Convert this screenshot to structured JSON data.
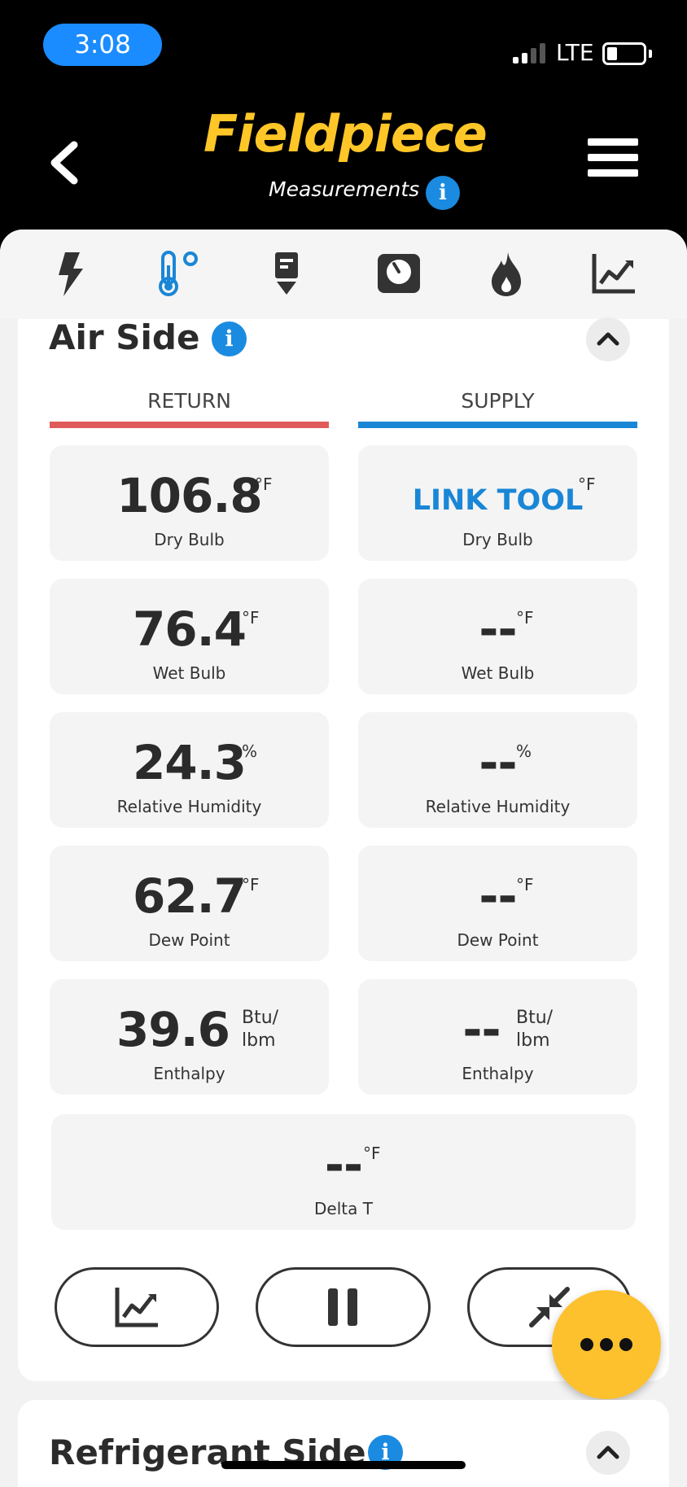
{
  "status": {
    "time": "3:08",
    "network": "LTE"
  },
  "header": {
    "brand": "Fieldpiece",
    "subtitle": "Measurements"
  },
  "tabs": [
    "lightning-icon",
    "thermometer-icon",
    "probe-icon",
    "gauge-icon",
    "flame-icon",
    "chart-icon"
  ],
  "air_side": {
    "title": "Air Side",
    "return_label": "RETURN",
    "supply_label": "SUPPLY",
    "return_color": "#e05a5a",
    "supply_color": "#1a86d6",
    "return": {
      "dry_bulb": {
        "value": "106.8",
        "unit": "°F",
        "label": "Dry Bulb"
      },
      "wet_bulb": {
        "value": "76.4",
        "unit": "°F",
        "label": "Wet Bulb"
      },
      "humidity": {
        "value": "24.3",
        "unit": "%",
        "label": "Relative Humidity"
      },
      "dew_point": {
        "value": "62.7",
        "unit": "°F",
        "label": "Dew Point"
      },
      "enthalpy": {
        "value": "39.6",
        "unit_line1": "Btu/",
        "unit_line2": "lbm",
        "label": "Enthalpy"
      }
    },
    "supply": {
      "dry_bulb": {
        "value": "LINK TOOL",
        "unit": "°F",
        "label": "Dry Bulb"
      },
      "wet_bulb": {
        "value": "--",
        "unit": "°F",
        "label": "Wet Bulb"
      },
      "humidity": {
        "value": "--",
        "unit": "%",
        "label": "Relative Humidity"
      },
      "dew_point": {
        "value": "--",
        "unit": "°F",
        "label": "Dew Point"
      },
      "enthalpy": {
        "value": "--",
        "unit_line1": "Btu/",
        "unit_line2": "lbm",
        "label": "Enthalpy"
      }
    },
    "delta_t": {
      "value": "--",
      "unit": "°F",
      "label": "Delta T"
    }
  },
  "refrigerant_side": {
    "title": "Refrigerant Side"
  }
}
